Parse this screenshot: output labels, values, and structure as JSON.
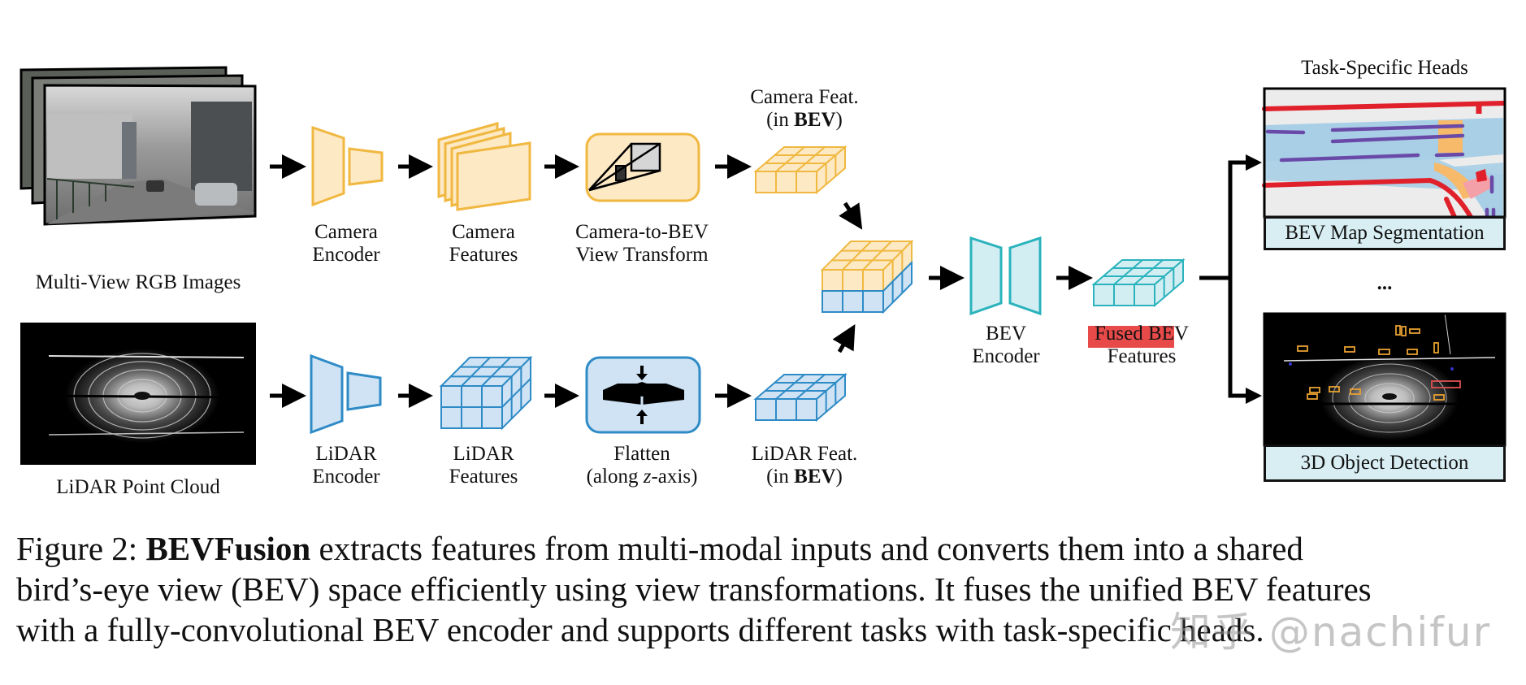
{
  "figure": {
    "number_label": "Figure 2:",
    "title_bold": "BEVFusion",
    "caption_lines": [
      " extracts features from multi-modal inputs and converts them into a shared",
      "bird’s-eye view (BEV) space efficiently using view transformations. It fuses the unified BEV features",
      "with a fully-convolutional BEV encoder and supports different tasks with task-specific heads."
    ],
    "watermark": "知乎 @nachifur"
  },
  "colors": {
    "camera_stroke": "#f0b840",
    "camera_fill": "#fde9c4",
    "lidar_stroke": "#2e8bc6",
    "lidar_fill": "#cfe3f4",
    "bev_stroke": "#2ab3bd",
    "bev_fill": "#d3eef2",
    "highlight": "#e84a4a",
    "map_road": "#a9cfe6",
    "map_boundary": "#e0202a",
    "map_divider": "#6a4aa8",
    "map_crossing": "#f7b96a",
    "panel_label_bg": "#d8eef3"
  },
  "camera_branch": {
    "input_label": "Multi-View RGB Images",
    "encoder_label": [
      "Camera",
      "Encoder"
    ],
    "features_label": [
      "Camera",
      "Features"
    ],
    "transform_label": [
      "Camera-to-BEV",
      "View Transform"
    ],
    "bev_label_line1": "Camera Feat.",
    "bev_label_line2_pre": "(in ",
    "bev_label_line2_bold": "BEV",
    "bev_label_line2_post": ")"
  },
  "lidar_branch": {
    "input_label": "LiDAR Point Cloud",
    "encoder_label": [
      "LiDAR",
      "Encoder"
    ],
    "features_label": [
      "LiDAR",
      "Features"
    ],
    "transform_label_line1": "Flatten",
    "transform_label_line2_pre": "(along ",
    "transform_label_line2_italic": "z",
    "transform_label_line2_post": "-axis)",
    "bev_label_line1": "LiDAR Feat.",
    "bev_label_line2_pre": "(in ",
    "bev_label_line2_bold": "BEV",
    "bev_label_line2_post": ")"
  },
  "fusion": {
    "encoder_label": [
      "BEV",
      "Encoder"
    ],
    "fused_label": [
      "Fused BEV",
      "Features"
    ]
  },
  "heads": {
    "title": "Task-Specific Heads",
    "ellipsis": "...",
    "items": [
      {
        "label": "BEV Map Segmentation"
      },
      {
        "label": "3D Object Detection"
      }
    ]
  }
}
